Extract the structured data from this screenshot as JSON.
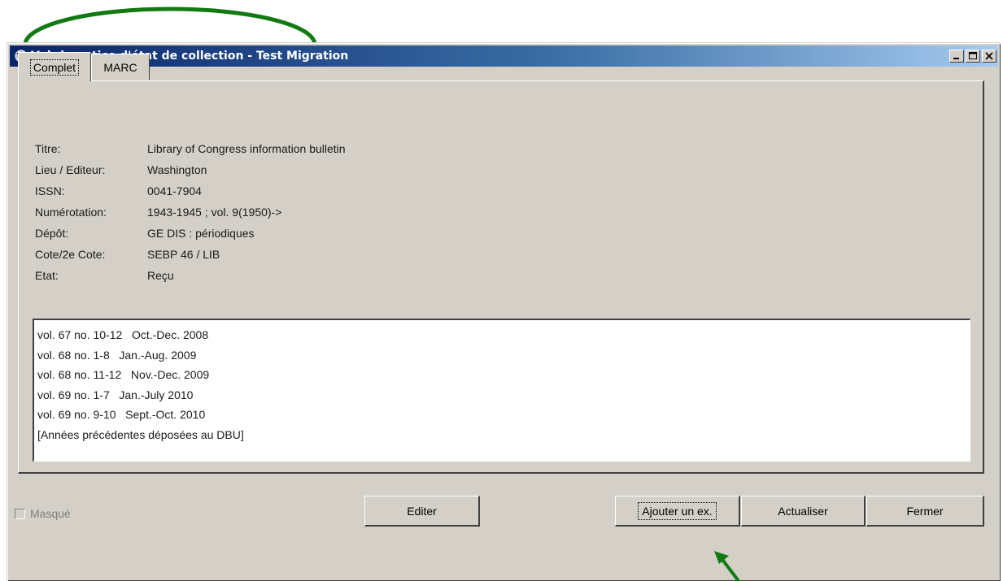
{
  "window": {
    "title": "Voir la notice d'état de collection - Test Migration",
    "controls": {
      "minimize": "minimize-icon",
      "maximize": "maximize-icon",
      "close": "close-icon"
    }
  },
  "tabs": [
    {
      "label": "Complet",
      "active": true
    },
    {
      "label": "MARC",
      "active": false
    }
  ],
  "record": [
    {
      "label": "Titre:",
      "value": "Library of Congress information bulletin"
    },
    {
      "label": "Lieu / Editeur:",
      "value": "Washington"
    },
    {
      "label": "ISSN:",
      "value": "0041-7904"
    },
    {
      "label": "Numérotation:",
      "value": "1943-1945 ; vol. 9(1950)->"
    },
    {
      "label": "Dépôt:",
      "value": "GE DIS : périodiques"
    },
    {
      "label": "Cote/2e Cote:",
      "value": "SEBP 46 / LIB"
    },
    {
      "label": "Etat:",
      "value": "Reçu"
    }
  ],
  "holdings": [
    "vol. 67 no. 10-12   Oct.-Dec. 2008",
    "vol. 68 no. 1-8   Jan.-Aug. 2009",
    "vol. 68 no. 11-12   Nov.-Dec. 2009",
    "vol. 69 no. 1-7   Jan.-July 2010",
    "vol. 69 no. 9-10   Sept.-Oct. 2010",
    "[Années précédentes déposées au DBU]"
  ],
  "checkbox": {
    "label": "Masqué",
    "checked": false,
    "disabled": true
  },
  "buttons": {
    "editer": "Editer",
    "ajouter": "Ajouter un ex.",
    "actualiser": "Actualiser",
    "fermer": "Fermer"
  },
  "colors": {
    "window_bg": "#d4d0c8",
    "titlebar_start": "#0a246a",
    "titlebar_end": "#a6caf0",
    "annotation": "#137a13"
  }
}
